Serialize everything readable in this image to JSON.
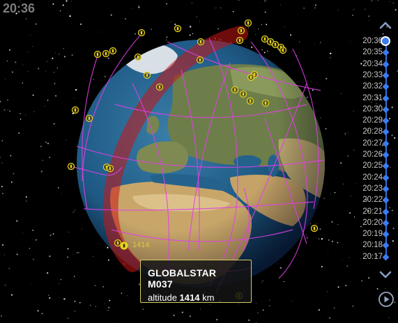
{
  "clock": "20:36",
  "timeline": {
    "current": "20:36",
    "times": [
      "20:36",
      "20:35",
      "20:34",
      "20:33",
      "20:32",
      "20:31",
      "20:30",
      "20:29",
      "20:28",
      "20:27",
      "20:26",
      "20:25",
      "20:24",
      "20:23",
      "20:22",
      "20:21",
      "20:20",
      "20:19",
      "20:18",
      "20:17"
    ],
    "up_icon": "chevron-up-icon",
    "down_icon": "chevron-down-icon",
    "play_icon": "play-icon"
  },
  "satellite_label": "1414",
  "tooltip": {
    "name": "GLOBALSTAR M037",
    "altitude_label": "altitude",
    "altitude_value": "1414",
    "altitude_unit": "km"
  },
  "colors": {
    "orbit": "#e040e8",
    "satellite": "#e6d21e",
    "track": "#c81414",
    "timeline_accent": "#3c7bf0"
  }
}
